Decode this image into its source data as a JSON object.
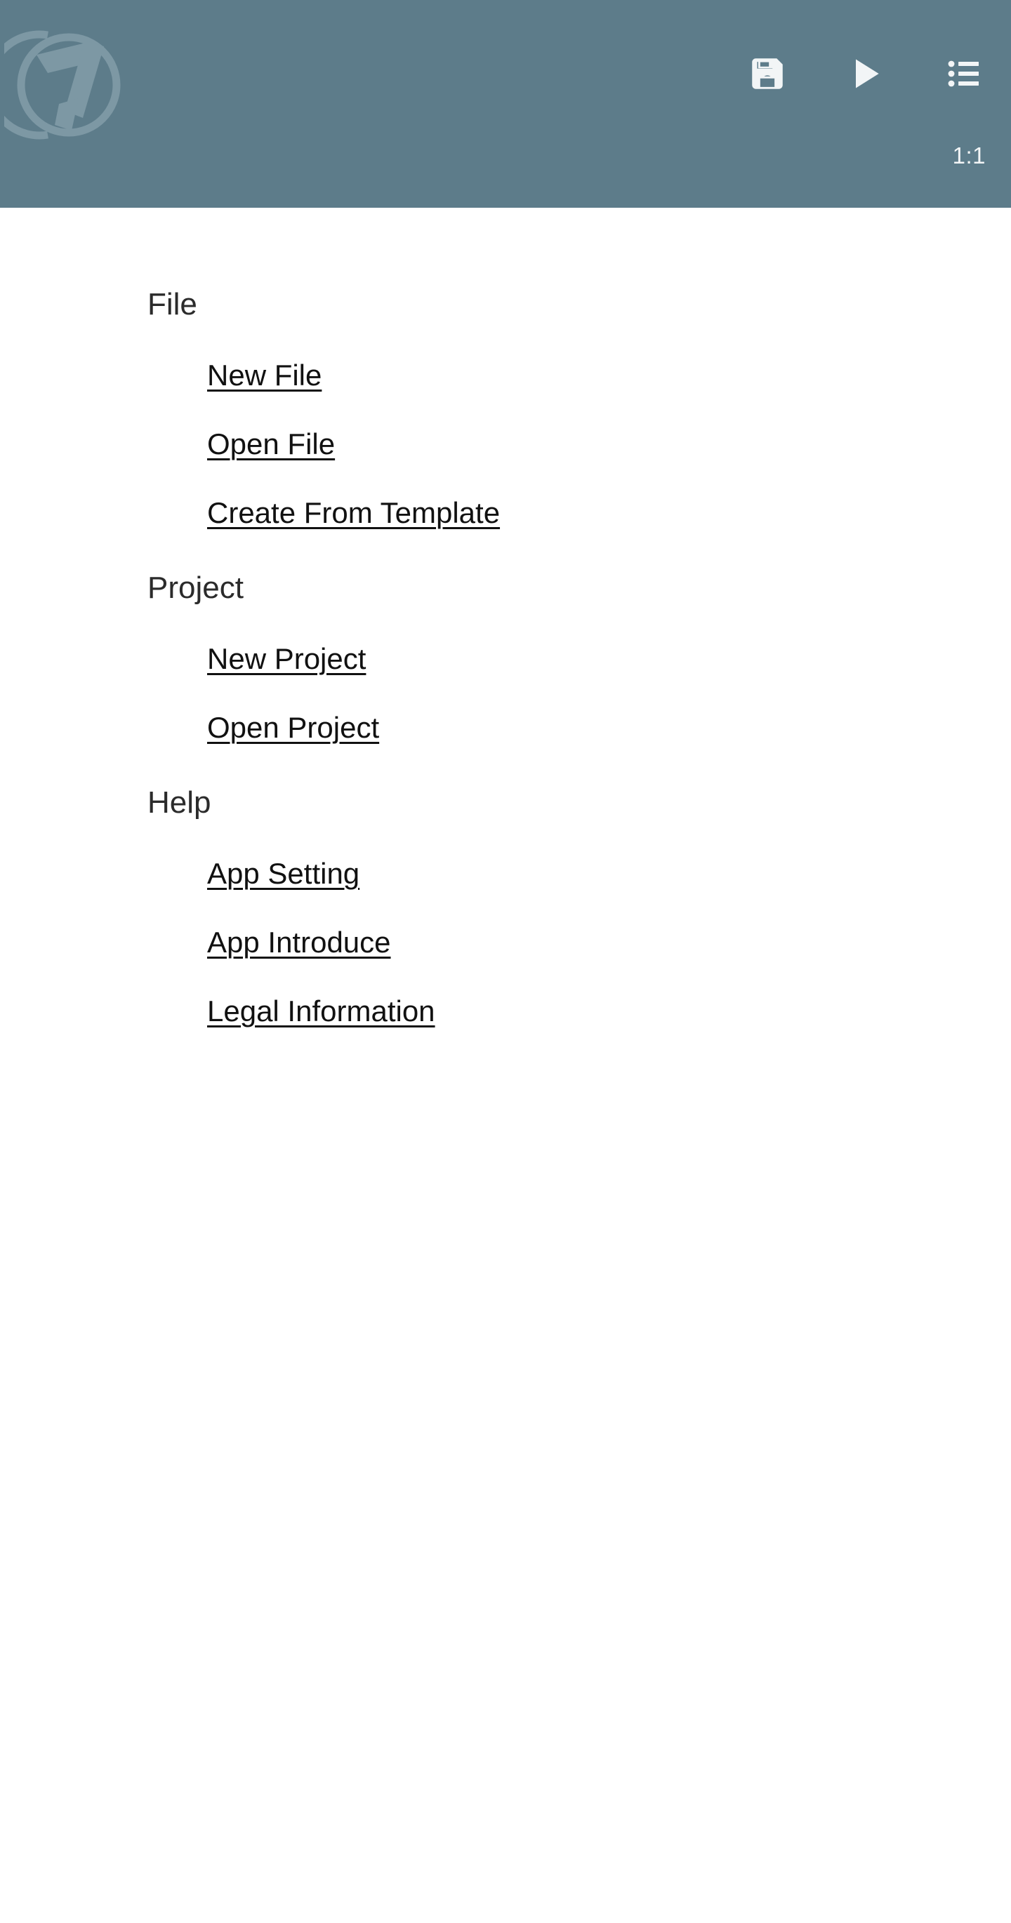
{
  "appbar": {
    "background_color": "#5d7c8a",
    "logo": {
      "name": "app-logo-watermark"
    },
    "ratio_label": "1:1",
    "actions": [
      {
        "name": "save-button",
        "icon": "save-icon",
        "label": "Save"
      },
      {
        "name": "run-button",
        "icon": "play-icon",
        "label": "Run"
      },
      {
        "name": "menu-button",
        "icon": "list-icon",
        "label": "Menu"
      }
    ]
  },
  "menu": {
    "sections": [
      {
        "title": "File",
        "items": [
          {
            "label": "New File"
          },
          {
            "label": "Open File"
          },
          {
            "label": "Create From Template"
          }
        ]
      },
      {
        "title": "Project",
        "items": [
          {
            "label": "New Project"
          },
          {
            "label": "Open Project"
          }
        ]
      },
      {
        "title": "Help",
        "items": [
          {
            "label": "App Setting"
          },
          {
            "label": "App Introduce"
          },
          {
            "label": "Legal Information"
          }
        ]
      }
    ]
  },
  "colors": {
    "appbar": "#5d7c8a",
    "appbar_icon": "#f2f5f6",
    "body_background": "#ffffff",
    "section_title": "#2b2b2b",
    "menu_item": "#111111"
  }
}
